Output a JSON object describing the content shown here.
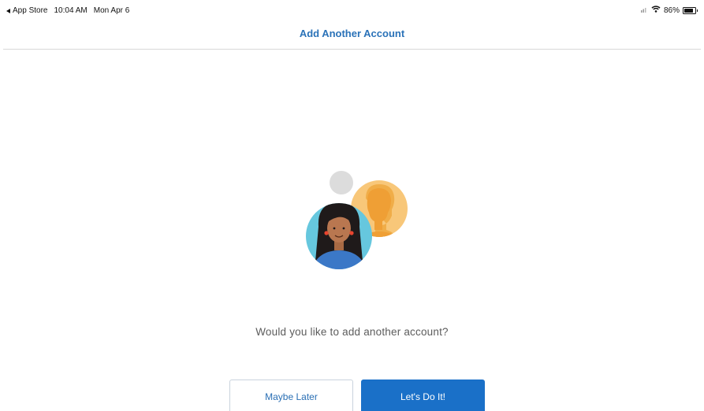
{
  "status_bar": {
    "back_app": "App Store",
    "time": "10:04 AM",
    "date": "Mon Apr 6",
    "battery_percent": "86%",
    "battery_level": 0.86,
    "icons": [
      "signal-icon",
      "wifi-icon",
      "battery-icon"
    ]
  },
  "nav": {
    "title": "Add Another Account"
  },
  "illustration": {
    "icon": "add-account-people-illustration"
  },
  "prompt": "Would you like to add another account?",
  "buttons": {
    "secondary_label": "Maybe Later",
    "primary_label": "Let's Do It!"
  },
  "colors": {
    "accent": "#2a72b8",
    "primary_button": "#1a70c8",
    "avatar_orange": "#f5b65a",
    "avatar_blue": "#66c7de",
    "grey_circle": "#dcdcdc"
  }
}
